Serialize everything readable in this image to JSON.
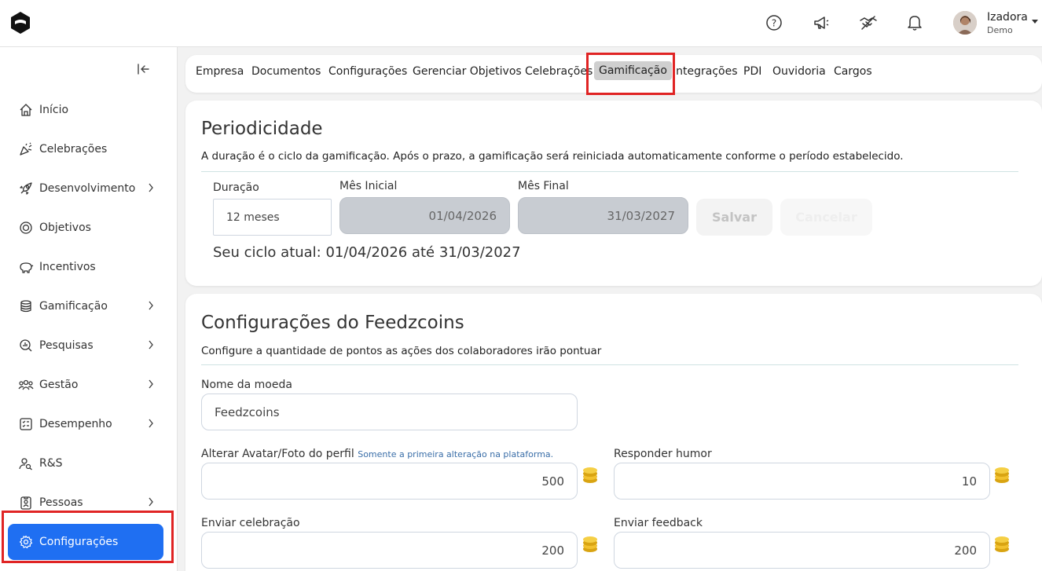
{
  "topbar": {
    "user_name": "Izadora",
    "user_role": "Demo",
    "icons": [
      "help-icon",
      "megaphone-icon",
      "handshake-icon",
      "bell-icon"
    ]
  },
  "sidebar": {
    "items": [
      {
        "label": "Início",
        "icon": "home-icon",
        "has_children": false
      },
      {
        "label": "Celebrações",
        "icon": "party-icon",
        "has_children": false
      },
      {
        "label": "Desenvolvimento",
        "icon": "rocket-icon",
        "has_children": true
      },
      {
        "label": "Objetivos",
        "icon": "target-icon",
        "has_children": false
      },
      {
        "label": "Incentivos",
        "icon": "piggy-bank-icon",
        "has_children": false
      },
      {
        "label": "Gamificação",
        "icon": "coins-icon",
        "has_children": true
      },
      {
        "label": "Pesquisas",
        "icon": "search-chart-icon",
        "has_children": true
      },
      {
        "label": "Gestão",
        "icon": "team-icon",
        "has_children": true
      },
      {
        "label": "Desempenho",
        "icon": "checklist-icon",
        "has_children": true
      },
      {
        "label": "R&S",
        "icon": "user-search-icon",
        "has_children": false
      },
      {
        "label": "Pessoas",
        "icon": "badge-icon",
        "has_children": true
      },
      {
        "label": "Configurações",
        "icon": "gear-icon",
        "has_children": false,
        "active": true
      }
    ]
  },
  "tabs": [
    "Empresa",
    "Documentos",
    "Configurações",
    "Gerenciar Objetivos",
    "Celebrações",
    "Gamificação",
    "Integrações",
    "PDI",
    "Ouvidoria",
    "Cargos"
  ],
  "active_tab": "Gamificação",
  "periodicidade": {
    "title": "Periodicidade",
    "description": "A duração é o ciclo da gamificação. Após o prazo, a gamificação será reiniciada automaticamente conforme o período estabelecido.",
    "duracao_label": "Duração",
    "duracao_value": "12 meses",
    "mes_inicial_label": "Mês Inicial",
    "mes_inicial_value": "01/04/2026",
    "mes_final_label": "Mês Final",
    "mes_final_value": "31/03/2027",
    "save_label": "Salvar",
    "cancel_label": "Cancelar",
    "cycle_text": "Seu ciclo atual: 01/04/2026 até 31/03/2027"
  },
  "feedzcoins": {
    "title": "Configurações do Feedzcoins",
    "description": "Configure a quantidade de pontos as ações dos colaboradores irão pontuar",
    "currency_label": "Nome da moeda",
    "currency_value": "Feedzcoins",
    "avatar_label": "Alterar Avatar/Foto do perfil",
    "avatar_note": "Somente a primeira alteração na plataforma.",
    "avatar_value": "500",
    "humor_label": "Responder humor",
    "humor_value": "10",
    "celebracao_label": "Enviar celebração",
    "celebracao_value": "200",
    "feedback_label": "Enviar feedback",
    "feedback_value": "200"
  },
  "colors": {
    "accent": "#1f6ff2",
    "highlight": "#e02424",
    "coin": "#f2c12e"
  }
}
